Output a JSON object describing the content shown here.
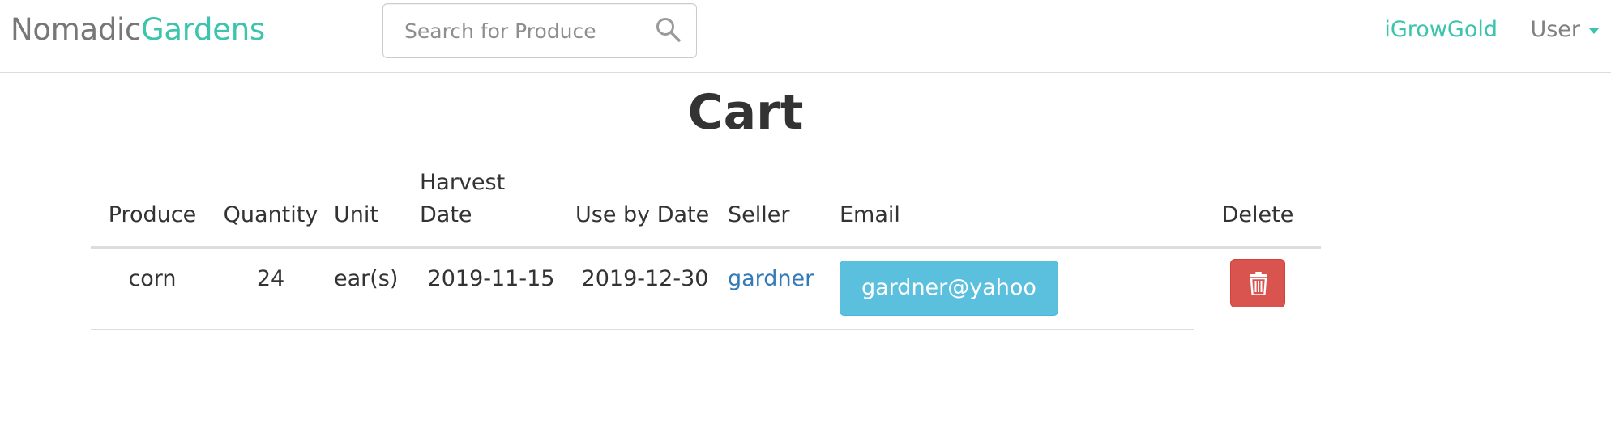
{
  "navbar": {
    "brand_part1": "Nomadic",
    "brand_part2": "Gardens",
    "search": {
      "placeholder": "Search for Produce",
      "value": "",
      "icon": "search-icon"
    },
    "user_link": "iGrowGold",
    "user_menu": "User",
    "user_menu_icon": "caret-down-icon"
  },
  "page": {
    "title": "Cart"
  },
  "cart": {
    "headers": {
      "produce": "Produce",
      "quantity": "Quantity",
      "unit": "Unit",
      "harvest_date": "Harvest Date",
      "use_by_date": "Use by Date",
      "seller": "Seller",
      "email": "Email",
      "delete": "Delete"
    },
    "rows": [
      {
        "produce": "corn",
        "quantity": "24",
        "unit": "ear(s)",
        "harvest_date": "2019-11-15",
        "use_by_date": "2019-12-30",
        "seller": "gardner",
        "email": "gardner@yahoo",
        "delete_icon": "trash-icon"
      }
    ]
  },
  "colors": {
    "brand_accent": "#3cc4ad",
    "brand_gray": "#777777",
    "link_blue": "#337ab7",
    "info_button": "#5bc0de",
    "danger_button": "#d9534f"
  }
}
